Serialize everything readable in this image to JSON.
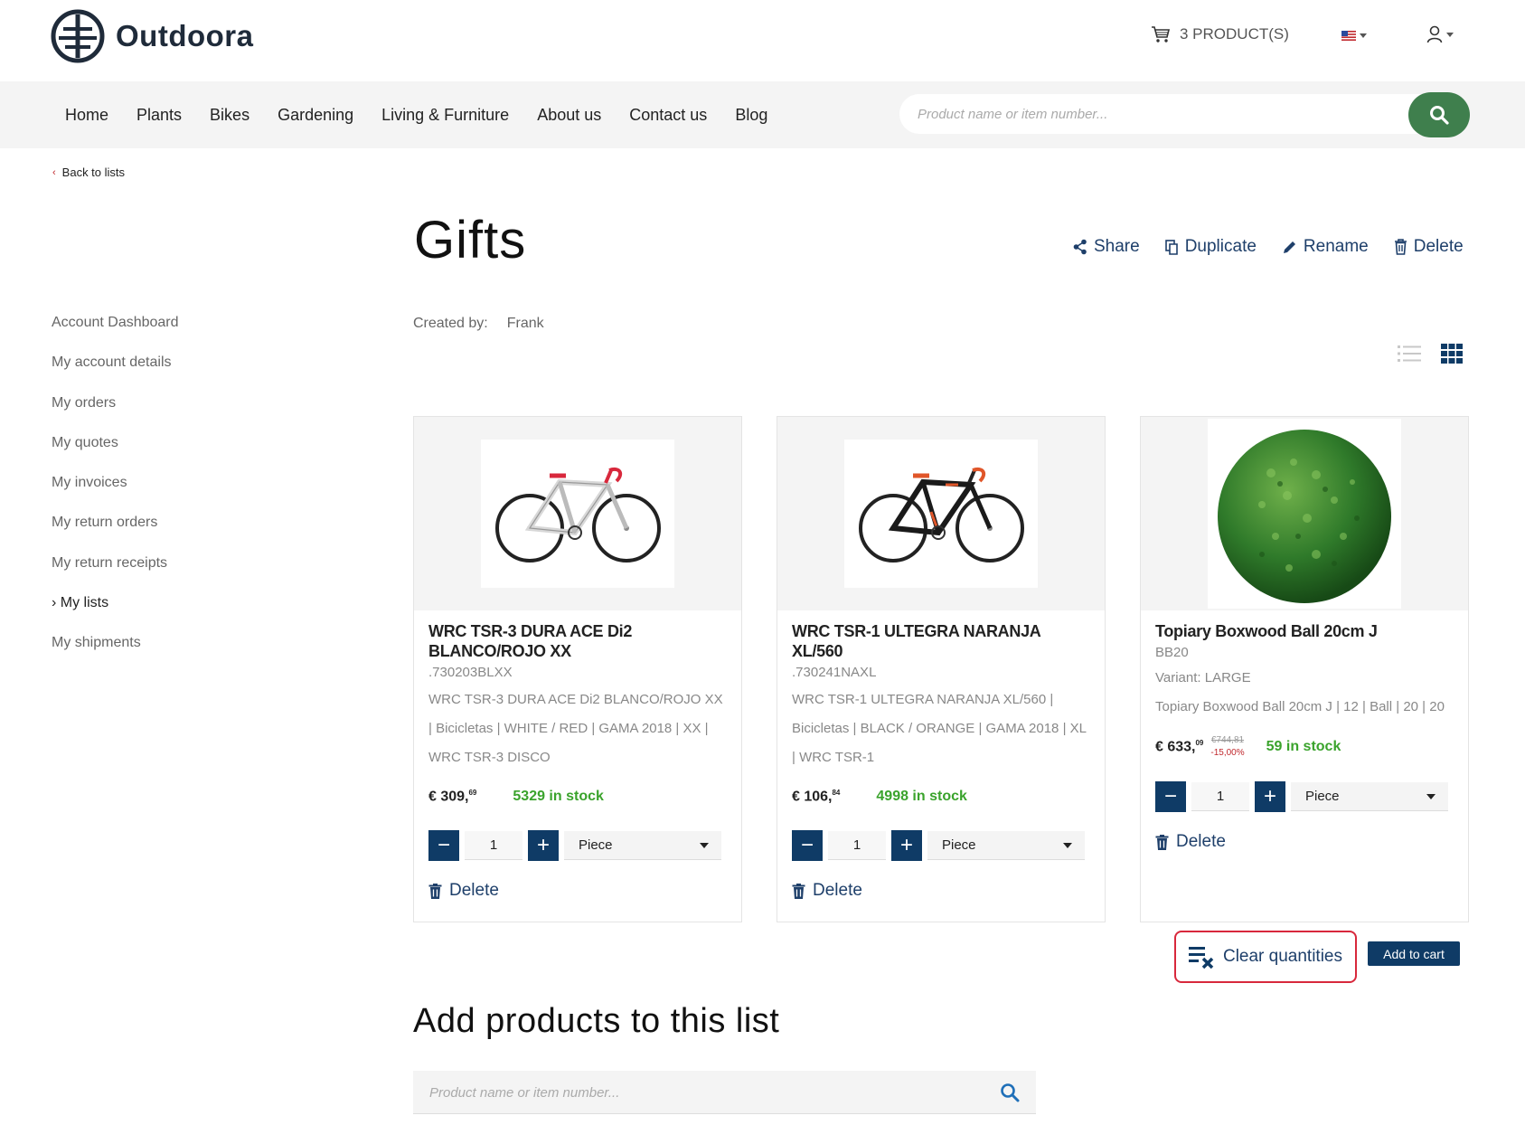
{
  "header": {
    "brand": "Outdoora",
    "cart_label": "3 PRODUCT(S)",
    "search_placeholder": "Product name or item number..."
  },
  "nav": {
    "items": [
      "Home",
      "Plants",
      "Bikes",
      "Gardening",
      "Living & Furniture",
      "About us",
      "Contact us",
      "Blog"
    ]
  },
  "back_label": "Back to lists",
  "sidebar": {
    "items": [
      "Account Dashboard",
      "My account details",
      "My orders",
      "My quotes",
      "My invoices",
      "My return orders",
      "My return receipts",
      "My lists",
      "My shipments"
    ],
    "active_marker": "›"
  },
  "list": {
    "title": "Gifts",
    "actions": {
      "share": "Share",
      "duplicate": "Duplicate",
      "rename": "Rename",
      "delete": "Delete"
    },
    "created_by_label": "Created by:",
    "created_by_value": "Frank"
  },
  "products": [
    {
      "name": "WRC TSR-3 DURA ACE Di2 BLANCO/ROJO XX",
      "sku": ".730203BLXX",
      "description": "WRC TSR-3 DURA ACE Di2 BLANCO/ROJO XX | Bicicletas | WHITE / RED | GAMA 2018 | XX | WRC TSR-3 DISCO",
      "price_main": "€ 309,",
      "price_cents": "69",
      "stock": "5329 in stock",
      "quantity": "1",
      "unit": "Piece",
      "delete_label": "Delete",
      "image": "road-bike-white-red"
    },
    {
      "name": "WRC TSR-1 ULTEGRA NARANJA XL/560",
      "sku": ".730241NAXL",
      "description": "WRC TSR-1 ULTEGRA NARANJA XL/560 | Bicicletas | BLACK / ORANGE | GAMA 2018 | XL | WRC TSR-1",
      "price_main": "€ 106,",
      "price_cents": "84",
      "stock": "4998 in stock",
      "quantity": "1",
      "unit": "Piece",
      "delete_label": "Delete",
      "image": "road-bike-black-orange"
    },
    {
      "name": "Topiary Boxwood Ball 20cm J",
      "sku": "BB20",
      "variant": "Variant: LARGE",
      "description": "Topiary Boxwood Ball 20cm J | 12 | Ball | 20 | 20",
      "price_main": "€ 633,",
      "price_cents": "09",
      "old_price": "€744,81",
      "discount": "-15,00%",
      "stock": "59 in stock",
      "quantity": "1",
      "unit": "Piece",
      "delete_label": "Delete",
      "image": "boxwood-ball"
    }
  ],
  "footer_actions": {
    "clear_quantities": "Clear quantities",
    "add_to_cart": "Add to cart"
  },
  "add_products": {
    "title": "Add products to this list",
    "search_placeholder": "Product name or item number..."
  },
  "colors": {
    "primary": "#0f3b66",
    "search_button": "#3f7f4d",
    "stock": "#3aa32c",
    "highlight": "#d8283c"
  }
}
